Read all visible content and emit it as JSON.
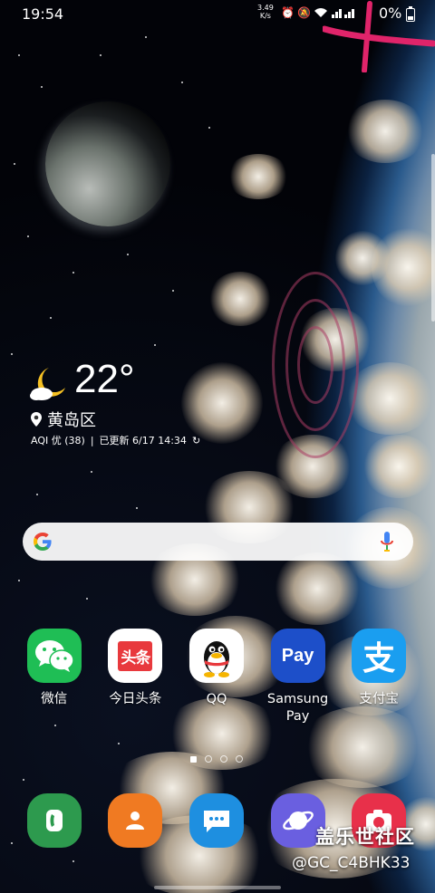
{
  "status_bar": {
    "time": "19:54",
    "net_speed": "3.49\nK/s",
    "battery_pct": "0%",
    "icons": [
      "alarm-icon",
      "mute-icon",
      "wifi-icon",
      "signal-icon",
      "battery-icon"
    ]
  },
  "weather": {
    "temperature": "22°",
    "condition_icon": "moon-cloud-icon",
    "location": "黄岛区",
    "aqi": "AQI 优 (38)",
    "updated": "已更新 6/17 14:34"
  },
  "search": {
    "icons": [
      "google-g-icon",
      "microphone-icon"
    ]
  },
  "apps": [
    {
      "label": "微信",
      "icon": "wechat-icon",
      "color": "#1fbe55"
    },
    {
      "label": "今日头条",
      "icon": "toutiao-icon",
      "color": "#ffffff"
    },
    {
      "label": "QQ",
      "icon": "qq-penguin-icon",
      "color": "#ffffff"
    },
    {
      "label": "Samsung\nPay",
      "icon": "samsung-pay-icon",
      "color": "#1d4fc9"
    },
    {
      "label": "支付宝",
      "icon": "alipay-icon",
      "color": "#1a9ef0"
    }
  ],
  "page_indicator": {
    "pages": 4,
    "current": 0
  },
  "dock": [
    {
      "icon": "phone-icon",
      "color": "#2d9a4e"
    },
    {
      "icon": "contacts-icon",
      "color": "#f07a22"
    },
    {
      "icon": "messages-icon",
      "color": "#1e8fe0"
    },
    {
      "icon": "internet-icon",
      "color": "#6a5fe0"
    },
    {
      "icon": "camera-icon",
      "color": "#e8304a"
    }
  ],
  "watermark": {
    "line1": "盖乐世社区",
    "line2": "@GC_C4BHK33"
  },
  "colors": {
    "toutiao_red": "#e8393d",
    "scribble": "#e0246a"
  }
}
